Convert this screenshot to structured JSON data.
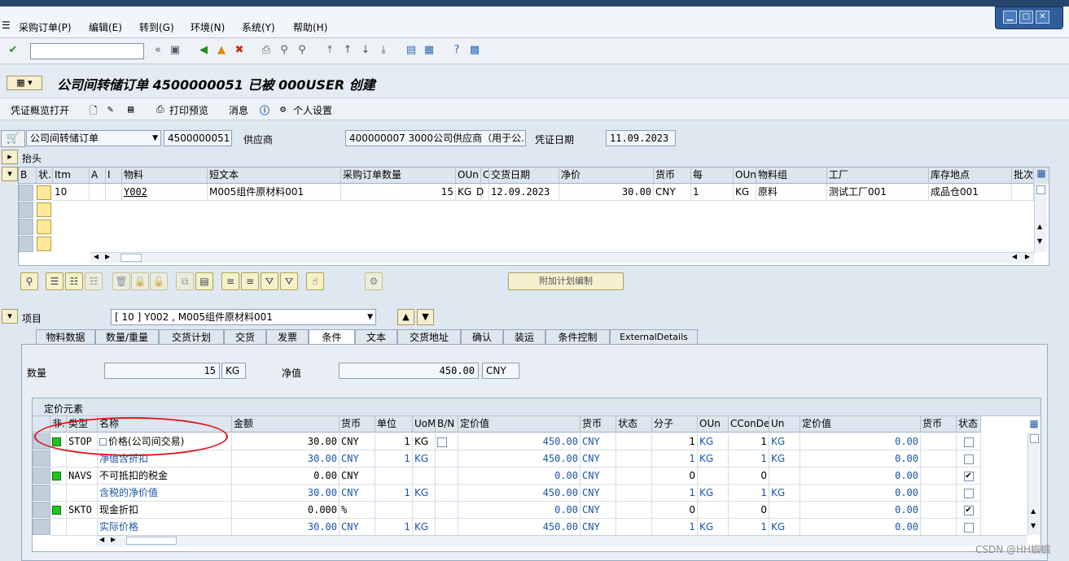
{
  "menubar": {
    "items": [
      "采购订单(P)",
      "编辑(E)",
      "转到(G)",
      "环境(N)",
      "系统(Y)",
      "帮助(H)"
    ]
  },
  "page_title": "公司间转储订单 4500000051 已被 000USER 创建",
  "app_toolbar": {
    "overview": "凭证概览打开",
    "print_preview": "打印预览",
    "messages": "消息",
    "personal_settings": "个人设置"
  },
  "header": {
    "doc_type": "公司间转储订单",
    "po_number": "4500000051",
    "vendor_label": "供应商",
    "vendor_value": "400000007 3000公司供应商（用于公...",
    "doc_date_label": "凭证日期",
    "doc_date_value": "11.09.2023",
    "header_label": "抬头"
  },
  "item_table": {
    "columns": [
      "B",
      "状.",
      "Itm",
      "A",
      "I",
      "物料",
      "短文本",
      "采购订单数量",
      "OUn",
      "C",
      "交货日期",
      "净价",
      "货币",
      "每",
      "OUn",
      "物料组",
      "工厂",
      "库存地点",
      "批次"
    ],
    "row": {
      "itm": "10",
      "material": "Y002",
      "short_text": "M005组件原材料001",
      "qty": "15",
      "oun": "KG",
      "c": "D",
      "delivery_date": "12.09.2023",
      "net_price": "30.00",
      "currency": "CNY",
      "per": "1",
      "oun2": "KG",
      "mat_group": "原料",
      "plant": "测试工厂001",
      "sloc": "成品仓001"
    }
  },
  "schedule_button": "附加计划编制",
  "item_section": {
    "label": "项目",
    "selected": "[ 10 ] Y002 , M005组件原材料001"
  },
  "tabs": [
    "物料数据",
    "数量/重量",
    "交货计划",
    "交货",
    "发票",
    "条件",
    "文本",
    "交货地址",
    "确认",
    "装运",
    "条件控制",
    "ExternalDetails"
  ],
  "active_tab": "条件",
  "conditions": {
    "qty_label": "数量",
    "qty_value": "15",
    "qty_unit": "KG",
    "net_label": "净值",
    "net_value": "450.00",
    "net_currency": "CNY",
    "pricing_title": "定价元素",
    "columns": [
      "非.",
      "类型",
      "名称",
      "金额",
      "货币",
      "单位",
      "UoM",
      "B/N",
      "定价值",
      "货币",
      "状态",
      "分子",
      "OUn",
      "CConDe",
      "Un",
      "定价值",
      "货币",
      "状态"
    ],
    "rows": [
      {
        "type": "STOP",
        "name": "价格(公司间交易)",
        "amount": "30.00",
        "curr": "CNY",
        "unit": "1",
        "uom": "KG",
        "bn": true,
        "cond_value": "450.00",
        "curr2": "CNY",
        "num": "1",
        "oun": "KG",
        "ccon": "1",
        "un": "KG",
        "value2": "0.00",
        "status": false,
        "green": true,
        "blue": false
      },
      {
        "type": "",
        "name": "净值含折扣",
        "amount": "30.00",
        "curr": "CNY",
        "unit": "1",
        "uom": "KG",
        "bn": false,
        "cond_value": "450.00",
        "curr2": "CNY",
        "num": "1",
        "oun": "KG",
        "ccon": "1",
        "un": "KG",
        "value2": "0.00",
        "status": false,
        "green": false,
        "blue": true
      },
      {
        "type": "NAVS",
        "name": "不可抵扣的税金",
        "amount": "0.00",
        "curr": "CNY",
        "unit": "",
        "uom": "",
        "bn": false,
        "cond_value": "0.00",
        "curr2": "CNY",
        "num": "0",
        "oun": "",
        "ccon": "0",
        "un": "",
        "value2": "0.00",
        "status": true,
        "green": true,
        "blue": false
      },
      {
        "type": "",
        "name": "含税的净价值",
        "amount": "30.00",
        "curr": "CNY",
        "unit": "1",
        "uom": "KG",
        "bn": false,
        "cond_value": "450.00",
        "curr2": "CNY",
        "num": "1",
        "oun": "KG",
        "ccon": "1",
        "un": "KG",
        "value2": "0.00",
        "status": false,
        "green": false,
        "blue": true
      },
      {
        "type": "SKTO",
        "name": "现金折扣",
        "amount": "0.000",
        "curr": "%",
        "unit": "",
        "uom": "",
        "bn": false,
        "cond_value": "0.00",
        "curr2": "CNY",
        "num": "0",
        "oun": "",
        "ccon": "0",
        "un": "",
        "value2": "0.00",
        "status": true,
        "green": true,
        "blue": false
      },
      {
        "type": "",
        "name": "实际价格",
        "amount": "30.00",
        "curr": "CNY",
        "unit": "1",
        "uom": "KG",
        "bn": false,
        "cond_value": "450.00",
        "curr2": "CNY",
        "num": "1",
        "oun": "KG",
        "ccon": "1",
        "un": "KG",
        "value2": "0.00",
        "status": false,
        "green": false,
        "blue": true
      }
    ]
  },
  "watermark": "CSDN @HH蝈蝈",
  "colors": {
    "header_bg": "#dfe7f0",
    "title_strip": "#28466c",
    "annotation_ellipse": "#e0141c",
    "link_blue": "#1a56a8"
  }
}
